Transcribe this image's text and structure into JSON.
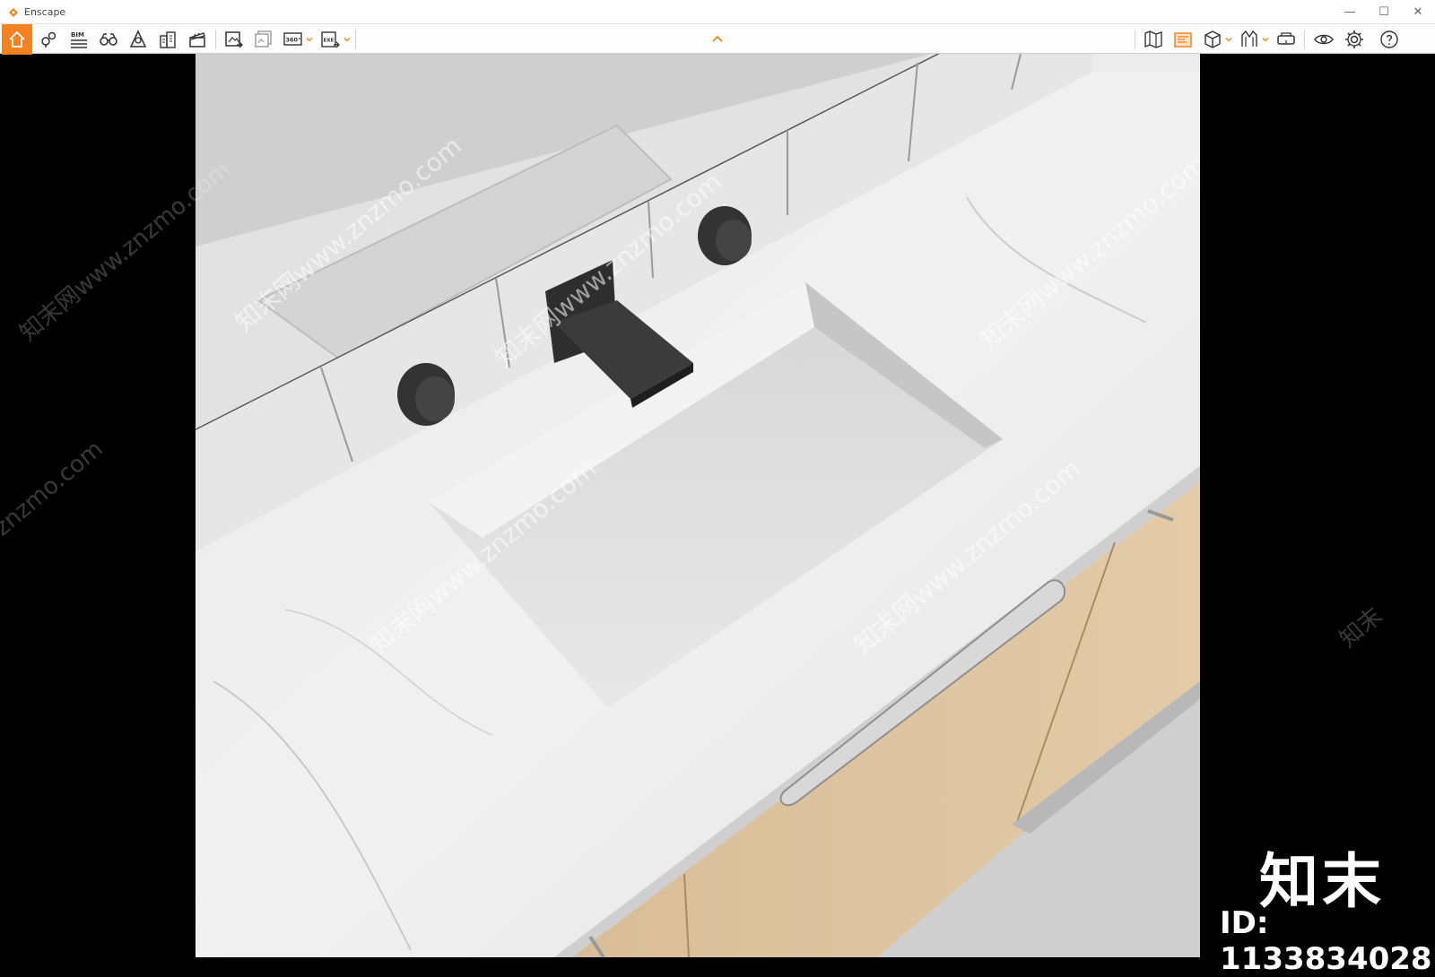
{
  "window": {
    "title": "Enscape",
    "controls": {
      "minimize": "—",
      "maximize": "☐",
      "close": "✕"
    }
  },
  "theme": {
    "accent": "#f58220",
    "toolbar_bg": "#fdfdfd",
    "viewport_side": "#000000"
  },
  "toolbar": {
    "left_tools": [
      {
        "name": "home-icon",
        "active": true
      },
      {
        "name": "location-pins-icon"
      },
      {
        "name": "bim-icon",
        "text": "BIM"
      },
      {
        "name": "binoculars-icon"
      },
      {
        "name": "atmosphere-icon"
      },
      {
        "name": "buildings-icon"
      },
      {
        "name": "clapperboard-icon"
      },
      {
        "name": "render-image-icon"
      },
      {
        "name": "batch-render-icon"
      },
      {
        "name": "panorama-360-icon",
        "text": "360°"
      },
      {
        "name": "exe-export-icon",
        "text": "EXE"
      }
    ],
    "right_tools": [
      {
        "name": "map-icon"
      },
      {
        "name": "gallery-icon",
        "active": true
      },
      {
        "name": "cube-view-icon"
      },
      {
        "name": "materials-icon"
      },
      {
        "name": "vr-headset-icon"
      },
      {
        "name": "visibility-eye-icon"
      },
      {
        "name": "settings-gear-icon"
      },
      {
        "name": "help-icon"
      }
    ]
  },
  "watermark": {
    "site": "znzmo.com",
    "site_full": "知末网www.znzmo.com",
    "brand": "知末",
    "id": "ID: 1133834028"
  }
}
